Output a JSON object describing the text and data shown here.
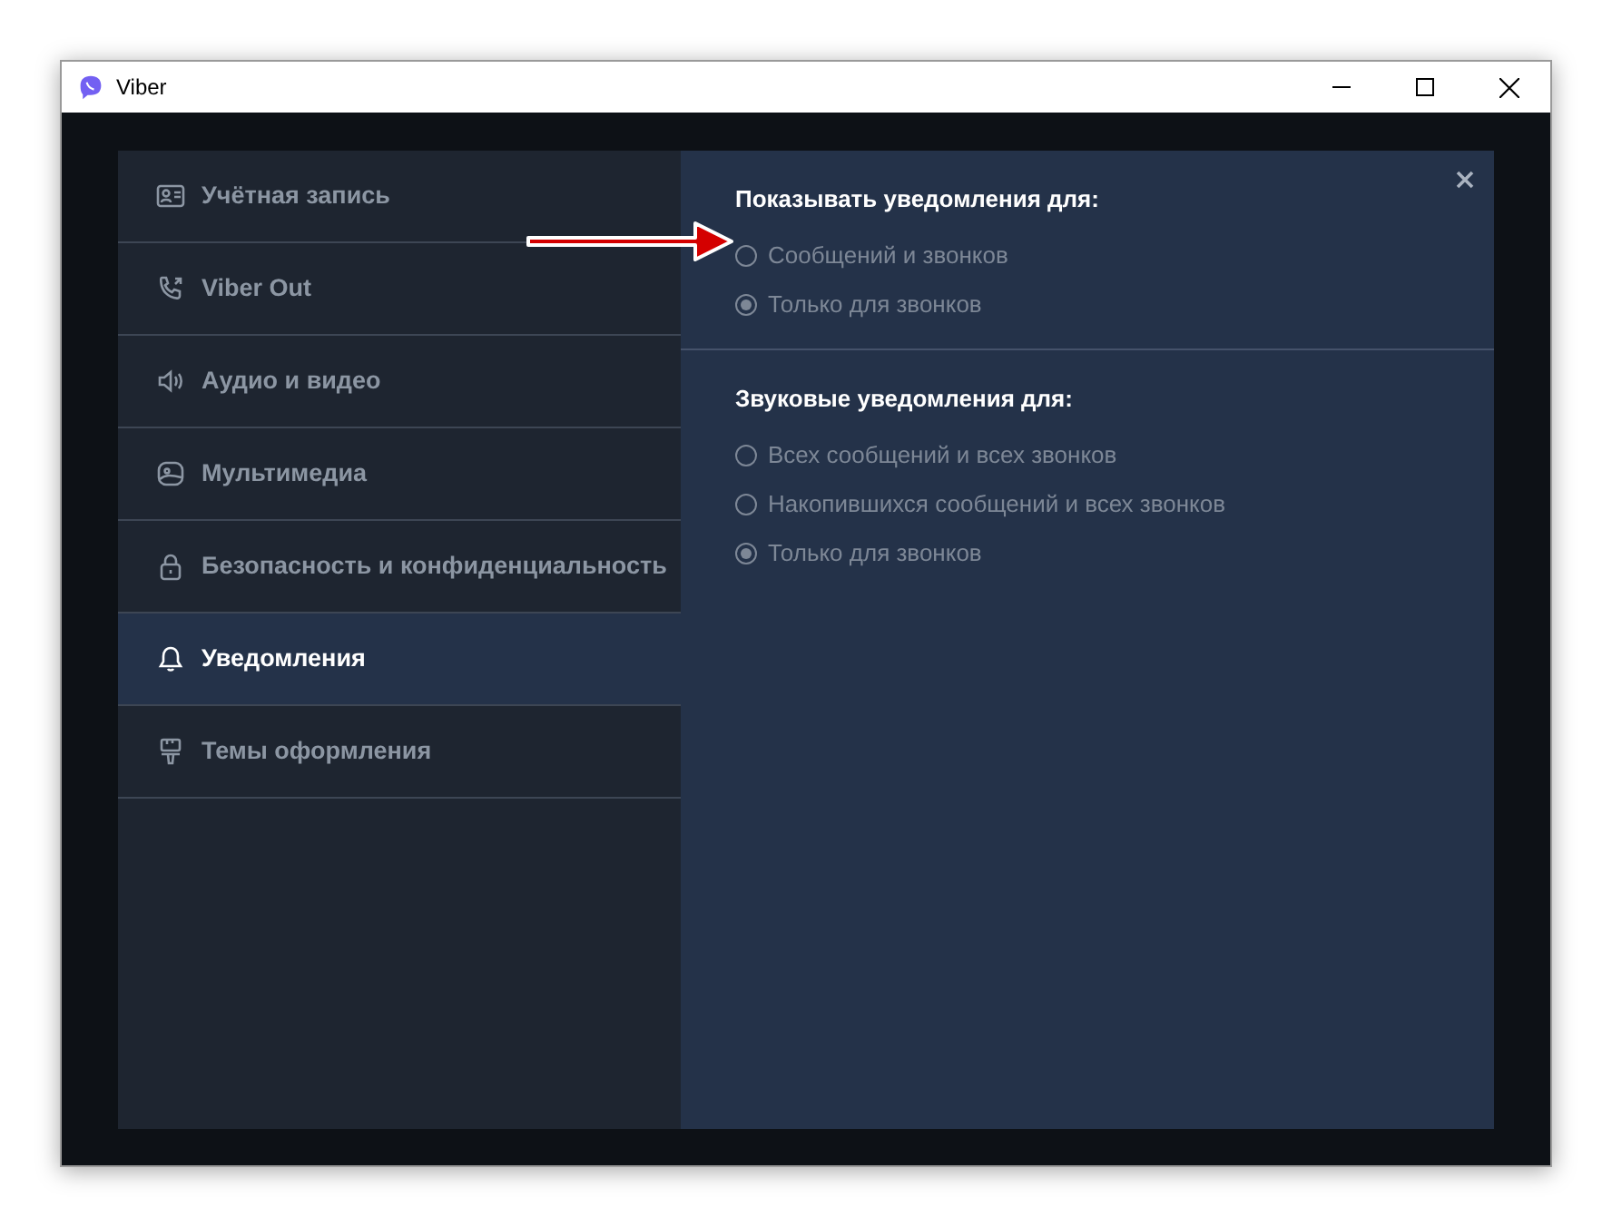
{
  "window": {
    "title": "Viber"
  },
  "settings_menu": {
    "items": [
      {
        "label": "Учётная запись",
        "selected": false
      },
      {
        "label": "Viber Out",
        "selected": false
      },
      {
        "label": "Аудио и видео",
        "selected": false
      },
      {
        "label": "Мультимедиа",
        "selected": false
      },
      {
        "label": "Безопасность и конфиденциальность",
        "selected": false
      },
      {
        "label": "Уведомления",
        "selected": true
      },
      {
        "label": "Темы оформления",
        "selected": false
      }
    ]
  },
  "sections": [
    {
      "heading": "Показывать уведомления для:",
      "options": [
        {
          "label": "Сообщений и звонков",
          "selected": false
        },
        {
          "label": "Только для звонков",
          "selected": true
        }
      ]
    },
    {
      "heading": "Звуковые уведомления для:",
      "options": [
        {
          "label": "Всех сообщений и всех звонков",
          "selected": false
        },
        {
          "label": "Накопившихся сообщений и всех звонков",
          "selected": false
        },
        {
          "label": "Только для звонков",
          "selected": true
        }
      ]
    }
  ]
}
